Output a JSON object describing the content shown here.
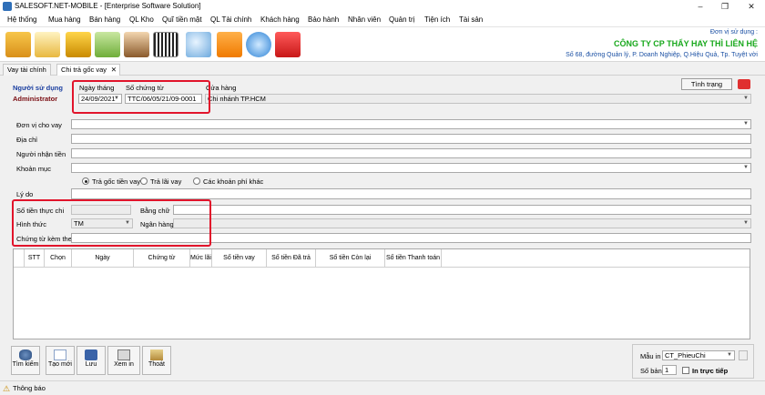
{
  "window": {
    "title": "SALESOFT.NET-MOBILE - [Enterprise Software Solution]",
    "minimize": "–",
    "restore": "❐",
    "close": "✕"
  },
  "menu": [
    "Hệ thống",
    "Mua hàng",
    "Bán hàng",
    "QL Kho",
    "Quĩ tiền mặt",
    "QL Tài chính",
    "Khách hàng",
    "Bảo hành",
    "Nhân viên",
    "Quản trị",
    "Tiện ích",
    "Tài sản"
  ],
  "company": {
    "label": "Đơn vị sử dụng :",
    "name": "CÔNG TY CP THẨY HAY THÌ LIÊN HỆ",
    "address": "Số 68, đường Quản lý, P. Doanh Nghiệp, Q.Hiệu Quả, Tp. Tuyệt vời"
  },
  "tabs": [
    "Vay tài chính",
    "Chi trả gốc vay"
  ],
  "tab_close": "✕",
  "header": {
    "user_label": "Người sử dụng",
    "user_value": "Administrator",
    "date_label": "Ngày tháng",
    "date_value": "24/09/2021",
    "doc_label": "Số chứng từ",
    "doc_value": "TTC/06/05/21/09-0001",
    "branch_label": "Cửa hàng",
    "branch_value": "Chi nhánh TP.HCM",
    "status_button": "Tình trạng"
  },
  "form": {
    "lender_label": "Đơn vị cho vay",
    "lender_value": "",
    "address_label": "Địa chỉ",
    "address_value": "",
    "receiver_label": "Người nhận tiền",
    "receiver_value": "",
    "item_label": "Khoản mục",
    "item_value": "",
    "radio_options": [
      "Trả gốc tiền vay",
      "Trả lãi vay",
      "Các khoản phí khác"
    ],
    "reason_label": "Lý do",
    "reason_value": "",
    "amount_label": "Số tiền thực chi",
    "amount_value": "",
    "in_words_label": "Bằng chữ",
    "in_words_value": "",
    "method_label": "Hình thức",
    "method_value": "TM",
    "bank_label": "Ngân hàng",
    "bank_value": "",
    "attach_label": "Chứng từ kèm theo",
    "attach_value": ""
  },
  "grid": {
    "columns": [
      "STT",
      "Chọn",
      "Ngày",
      "Chứng từ",
      "Mức lãi",
      "Số tiền vay",
      "Số tiền Đã trả",
      "Số tiền Còn lại",
      "Số tiền Thanh toán"
    ]
  },
  "buttons": [
    "Tìm kiếm",
    "Tạo mới",
    "Lưu",
    "Xem in",
    "Thoát"
  ],
  "print": {
    "template_label": "Mẫu in",
    "template_value": "CT_PhieuChi",
    "copies_label": "Số bản",
    "copies_value": "1",
    "direct_label": "In trực tiếp"
  },
  "status": "Thông báo",
  "colors": {
    "highlight": "#e1142b",
    "company_name": "#18a81c",
    "link_blue": "#1a4fa3"
  }
}
